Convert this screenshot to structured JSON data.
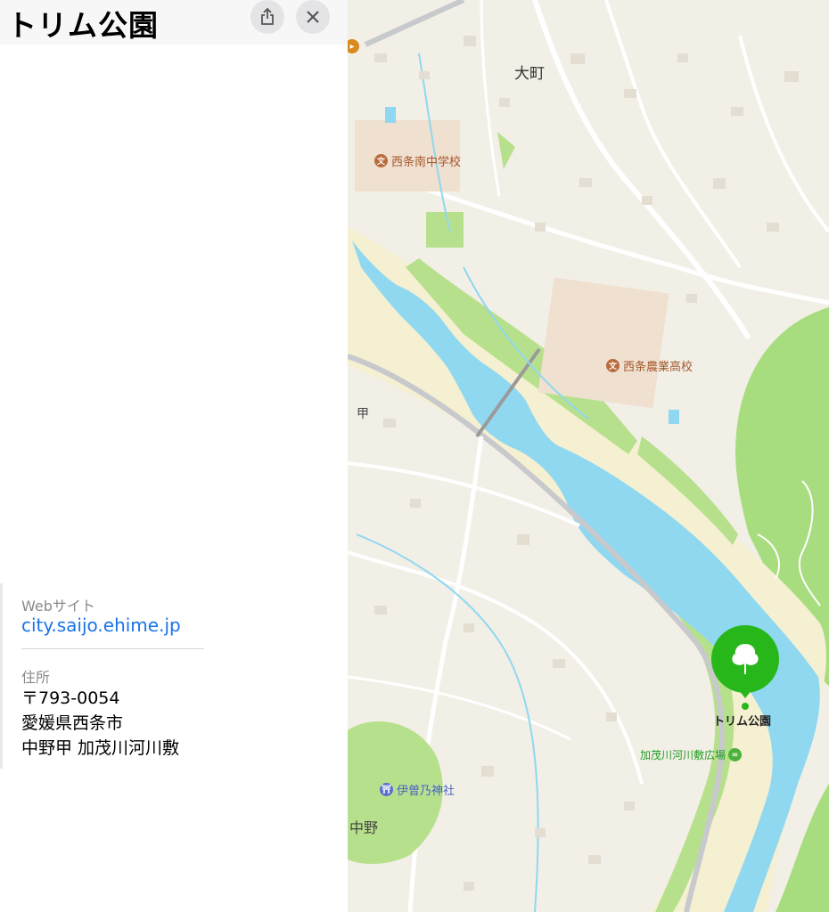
{
  "panel": {
    "title": "トリム公園",
    "share_icon": "share-icon",
    "close_icon": "close-icon",
    "website_label": "Webサイト",
    "website_value": "city.saijo.ehime.jp",
    "address_label": "住所",
    "address_lines": [
      "〒793-0054",
      "愛媛県西条市",
      "中野甲 加茂川河川敷"
    ]
  },
  "map": {
    "labels": {
      "omachi": "大町",
      "junior_high": "西条南中学校",
      "agri_high": "西条農業高校",
      "kou": "甲",
      "nakano": "中野",
      "shrine": "伊曽乃神社",
      "park_pin": "トリム公園",
      "plaza": "加茂川河川敷広場"
    },
    "icons": {
      "school": "school-icon",
      "shrine": "torii-icon",
      "park_pin": "tree-icon",
      "plaza": "park-icon",
      "transit": "transit-icon"
    },
    "colors": {
      "land": "#f2efe7",
      "river": "#8fd8f0",
      "riverbank": "#f5f0d2",
      "greenery": "#b7e08c",
      "forest": "#a8dd7f",
      "pin": "#28b71a",
      "road": "#ffffff",
      "school_text": "#a6582d",
      "shrine_text": "#4a62c8",
      "plaza_text": "#1f9b1f",
      "link": "#1a73e8"
    }
  }
}
